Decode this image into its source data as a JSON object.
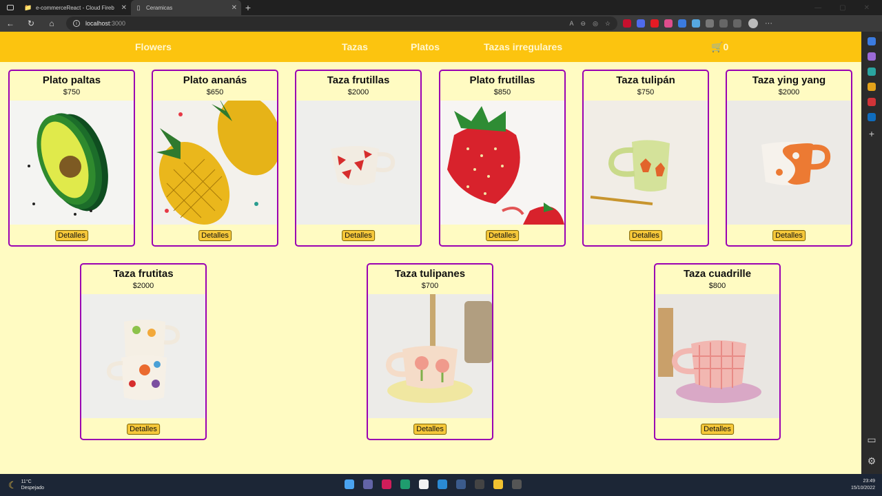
{
  "browser": {
    "tabs": [
      {
        "title": "e-commerceReact - Cloud Fireb",
        "icon": "folder-icon"
      },
      {
        "title": "Ceramicas",
        "icon": "page-icon"
      }
    ],
    "url_host": "localhost",
    "url_port": ":3000"
  },
  "site": {
    "brand": "Flowers",
    "nav": [
      "Tazas",
      "Platos",
      "Tazas irregulares"
    ],
    "cart_icon": "cart-icon",
    "cart_count": "0",
    "colors": {
      "navbar": "#fcc40f",
      "background": "#fffbc2",
      "card_border": "#9a00b2",
      "button": "#f6c83a"
    }
  },
  "products": [
    {
      "name": "Plato paltas",
      "price": "$750",
      "button": "Detalles",
      "image": "avocado-plate"
    },
    {
      "name": "Plato ananás",
      "price": "$650",
      "button": "Detalles",
      "image": "pineapple-plate"
    },
    {
      "name": "Taza frutillas",
      "price": "$2000",
      "button": "Detalles",
      "image": "strawberry-mug"
    },
    {
      "name": "Plato frutillas",
      "price": "$850",
      "button": "Detalles",
      "image": "strawberry-plate"
    },
    {
      "name": "Taza tulipán",
      "price": "$750",
      "button": "Detalles",
      "image": "tulip-mug"
    },
    {
      "name": "Taza ying yang",
      "price": "$2000",
      "button": "Detalles",
      "image": "yinyang-mug"
    },
    {
      "name": "Taza frutitas",
      "price": "$2000",
      "button": "Detalles",
      "image": "fruits-mug"
    },
    {
      "name": "Taza tulipanes",
      "price": "$700",
      "button": "Detalles",
      "image": "tulips-mug"
    },
    {
      "name": "Taza cuadrille",
      "price": "$800",
      "button": "Detalles",
      "image": "checkered-mug"
    }
  ],
  "taskbar": {
    "temperature": "11°C",
    "weather": "Despejado",
    "time": "23:49",
    "date": "15/10/2022"
  }
}
